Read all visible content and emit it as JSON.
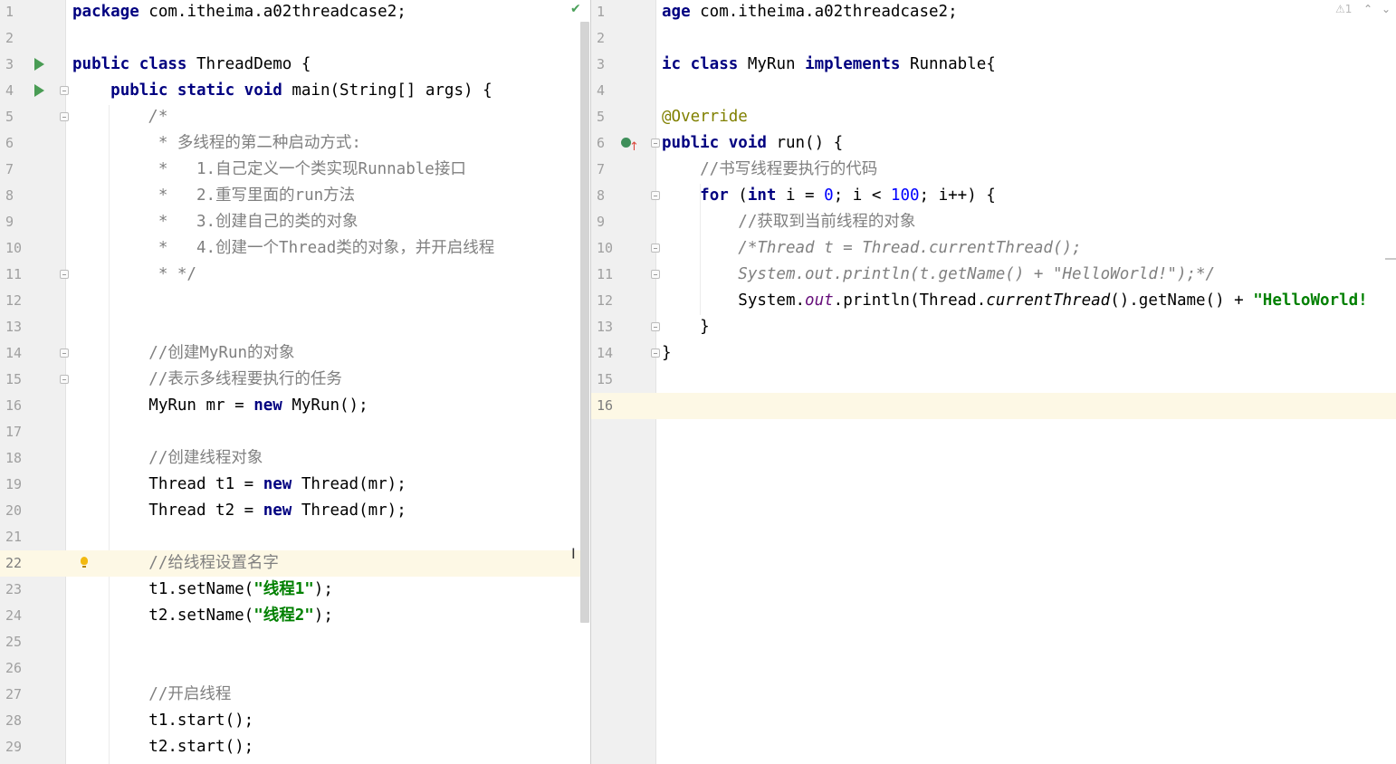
{
  "left_editor": {
    "check_icon": "check-icon",
    "lines": [
      {
        "n": "1",
        "tokens": [
          {
            "c": "kw",
            "t": "package"
          },
          {
            "c": "",
            "t": " com.itheima.a02threadcase2;"
          }
        ]
      },
      {
        "n": "2",
        "tokens": []
      },
      {
        "n": "3",
        "tokens": [
          {
            "c": "kw",
            "t": "public class"
          },
          {
            "c": "",
            "t": " ThreadDemo {"
          }
        ]
      },
      {
        "n": "4",
        "tokens": [
          {
            "c": "",
            "t": "    "
          },
          {
            "c": "kw",
            "t": "public static void"
          },
          {
            "c": "",
            "t": " main(String[] args) {"
          }
        ]
      },
      {
        "n": "5",
        "tokens": [
          {
            "c": "cmt-i",
            "t": "        /*"
          }
        ]
      },
      {
        "n": "6",
        "tokens": [
          {
            "c": "cmt",
            "t": "         * 多线程的第二种启动方式:"
          }
        ]
      },
      {
        "n": "7",
        "tokens": [
          {
            "c": "cmt",
            "t": "         *   1.自己定义一个类实现Runnable接口"
          }
        ]
      },
      {
        "n": "8",
        "tokens": [
          {
            "c": "cmt",
            "t": "         *   2.重写里面的run方法"
          }
        ]
      },
      {
        "n": "9",
        "tokens": [
          {
            "c": "cmt",
            "t": "         *   3.创建自己的类的对象"
          }
        ]
      },
      {
        "n": "10",
        "tokens": [
          {
            "c": "cmt",
            "t": "         *   4.创建一个Thread类的对象，并开启线程"
          }
        ]
      },
      {
        "n": "11",
        "tokens": [
          {
            "c": "cmt",
            "t": "         * */"
          }
        ]
      },
      {
        "n": "12",
        "tokens": []
      },
      {
        "n": "13",
        "tokens": []
      },
      {
        "n": "14",
        "tokens": [
          {
            "c": "cmt",
            "t": "        //创建MyRun的对象"
          }
        ]
      },
      {
        "n": "15",
        "tokens": [
          {
            "c": "cmt",
            "t": "        //表示多线程要执行的任务"
          }
        ]
      },
      {
        "n": "16",
        "tokens": [
          {
            "c": "",
            "t": "        MyRun mr = "
          },
          {
            "c": "kw",
            "t": "new"
          },
          {
            "c": "",
            "t": " MyRun();"
          }
        ]
      },
      {
        "n": "17",
        "tokens": []
      },
      {
        "n": "18",
        "tokens": [
          {
            "c": "cmt",
            "t": "        //创建线程对象"
          }
        ]
      },
      {
        "n": "19",
        "tokens": [
          {
            "c": "",
            "t": "        Thread t1 = "
          },
          {
            "c": "kw",
            "t": "new"
          },
          {
            "c": "",
            "t": " Thread(mr);"
          }
        ]
      },
      {
        "n": "20",
        "tokens": [
          {
            "c": "",
            "t": "        Thread t2 = "
          },
          {
            "c": "kw",
            "t": "new"
          },
          {
            "c": "",
            "t": " Thread(mr);"
          }
        ]
      },
      {
        "n": "21",
        "tokens": []
      },
      {
        "n": "22",
        "tokens": [
          {
            "c": "cmt",
            "t": "        //给线程设置名字"
          }
        ]
      },
      {
        "n": "23",
        "tokens": [
          {
            "c": "",
            "t": "        t1.setName("
          },
          {
            "c": "str",
            "t": "\"线程1\""
          },
          {
            "c": "",
            "t": ");"
          }
        ]
      },
      {
        "n": "24",
        "tokens": [
          {
            "c": "",
            "t": "        t2.setName("
          },
          {
            "c": "str",
            "t": "\"线程2\""
          },
          {
            "c": "",
            "t": ");"
          }
        ]
      },
      {
        "n": "25",
        "tokens": []
      },
      {
        "n": "26",
        "tokens": []
      },
      {
        "n": "27",
        "tokens": [
          {
            "c": "cmt",
            "t": "        //开启线程"
          }
        ]
      },
      {
        "n": "28",
        "tokens": [
          {
            "c": "",
            "t": "        t1.start();"
          }
        ]
      },
      {
        "n": "29",
        "tokens": [
          {
            "c": "",
            "t": "        t2.start();"
          }
        ]
      }
    ],
    "current_line": "22",
    "run_icon_lines": [
      "3",
      "4"
    ],
    "fold_lines": [
      "4",
      "5",
      "11",
      "14",
      "15"
    ],
    "bulb_line": "22"
  },
  "right_editor": {
    "warning_count": "1",
    "warning_icon": "warning-icon",
    "nav_up_icon": "chevron-up-icon",
    "nav_down_icon": "chevron-down-icon",
    "lines": [
      {
        "n": "1",
        "tokens": [
          {
            "c": "kw",
            "t": "age"
          },
          {
            "c": "",
            "t": " com.itheima.a02threadcase2;"
          }
        ]
      },
      {
        "n": "2",
        "tokens": []
      },
      {
        "n": "3",
        "tokens": [
          {
            "c": "kw",
            "t": "ic class"
          },
          {
            "c": "",
            "t": " MyRun "
          },
          {
            "c": "kw",
            "t": "implements"
          },
          {
            "c": "",
            "t": " Runnable{"
          }
        ]
      },
      {
        "n": "4",
        "tokens": []
      },
      {
        "n": "5",
        "tokens": [
          {
            "c": "ann",
            "t": "@Override"
          }
        ]
      },
      {
        "n": "6",
        "tokens": [
          {
            "c": "kw",
            "t": "public void"
          },
          {
            "c": "",
            "t": " run() {"
          }
        ]
      },
      {
        "n": "7",
        "tokens": [
          {
            "c": "cmt",
            "t": "    //书写线程要执行的代码"
          }
        ]
      },
      {
        "n": "8",
        "tokens": [
          {
            "c": "",
            "t": "    "
          },
          {
            "c": "kw",
            "t": "for"
          },
          {
            "c": "",
            "t": " ("
          },
          {
            "c": "kw",
            "t": "int"
          },
          {
            "c": "",
            "t": " i = "
          },
          {
            "c": "num",
            "t": "0"
          },
          {
            "c": "",
            "t": "; i < "
          },
          {
            "c": "num",
            "t": "100"
          },
          {
            "c": "",
            "t": "; i++) {"
          }
        ]
      },
      {
        "n": "9",
        "tokens": [
          {
            "c": "cmt",
            "t": "        //获取到当前线程的对象"
          }
        ]
      },
      {
        "n": "10",
        "tokens": [
          {
            "c": "cmt-i",
            "t": "        /*Thread t = Thread.currentThread();"
          }
        ]
      },
      {
        "n": "11",
        "tokens": [
          {
            "c": "cmt-i",
            "t": "        System.out.println(t.getName() + \"HelloWorld!\");*/"
          }
        ]
      },
      {
        "n": "12",
        "tokens": [
          {
            "c": "",
            "t": "        System."
          },
          {
            "c": "field",
            "t": "out"
          },
          {
            "c": "",
            "t": ".println(Thread."
          },
          {
            "c": "stat",
            "t": "currentThread"
          },
          {
            "c": "",
            "t": "().getName() + "
          },
          {
            "c": "str",
            "t": "\"HelloWorld!"
          }
        ]
      },
      {
        "n": "13",
        "tokens": [
          {
            "c": "",
            "t": "    }"
          }
        ]
      },
      {
        "n": "14",
        "tokens": [
          {
            "c": "",
            "t": "}"
          }
        ]
      },
      {
        "n": "15",
        "tokens": []
      },
      {
        "n": "16",
        "tokens": []
      }
    ],
    "current_line": "16",
    "override_line": "6",
    "fold_lines": [
      "6",
      "8",
      "10",
      "11",
      "13",
      "14"
    ]
  }
}
